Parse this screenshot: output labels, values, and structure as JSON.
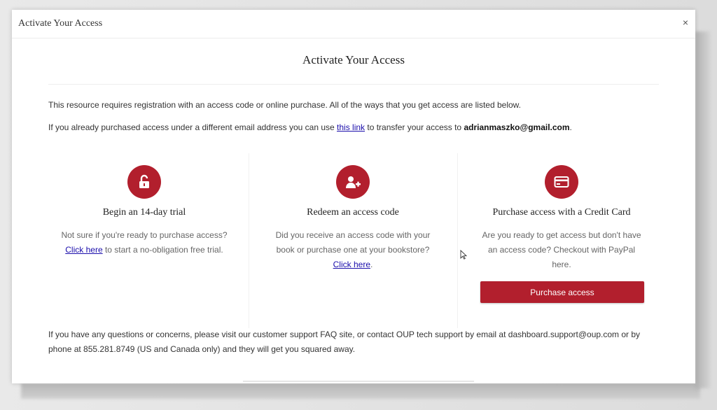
{
  "modal": {
    "header_title": "Activate Your Access",
    "close_glyph": "×",
    "heading": "Activate Your Access"
  },
  "intro": {
    "line1": "This resource requires registration with an access code or online purchase. All of the ways that you get access are listed below.",
    "line2_prefix": "If you already purchased access under a different email address you can use ",
    "line2_link": "this link",
    "line2_middle": " to transfer your access to ",
    "email": "adrianmaszko@gmail.com",
    "line2_suffix": "."
  },
  "options": {
    "trial": {
      "icon": "unlock-icon",
      "title": "Begin an 14-day trial",
      "desc_prefix": "Not sure if you're ready to purchase access? ",
      "link": "Click here",
      "desc_suffix": " to start a no-obligation free trial."
    },
    "redeem": {
      "icon": "user-plus-icon",
      "title": "Redeem an access code",
      "desc_prefix": "Did you receive an access code with your book or purchase one at your bookstore? ",
      "link": "Click here",
      "desc_suffix": "."
    },
    "purchase": {
      "icon": "credit-card-icon",
      "title": "Purchase access with a Credit Card",
      "desc": "Are you ready to get access but don't have an access code? Checkout with PayPal here.",
      "button_label": "Purchase access"
    }
  },
  "footer": {
    "text": "If you have any questions or concerns, please visit our customer support FAQ site, or contact OUP tech support by email at dashboard.support@oup.com or by phone at 855.281.8749 (US and Canada only) and they will get you squared away."
  },
  "colors": {
    "accent": "#b21f2d",
    "link": "#1a0dab"
  }
}
